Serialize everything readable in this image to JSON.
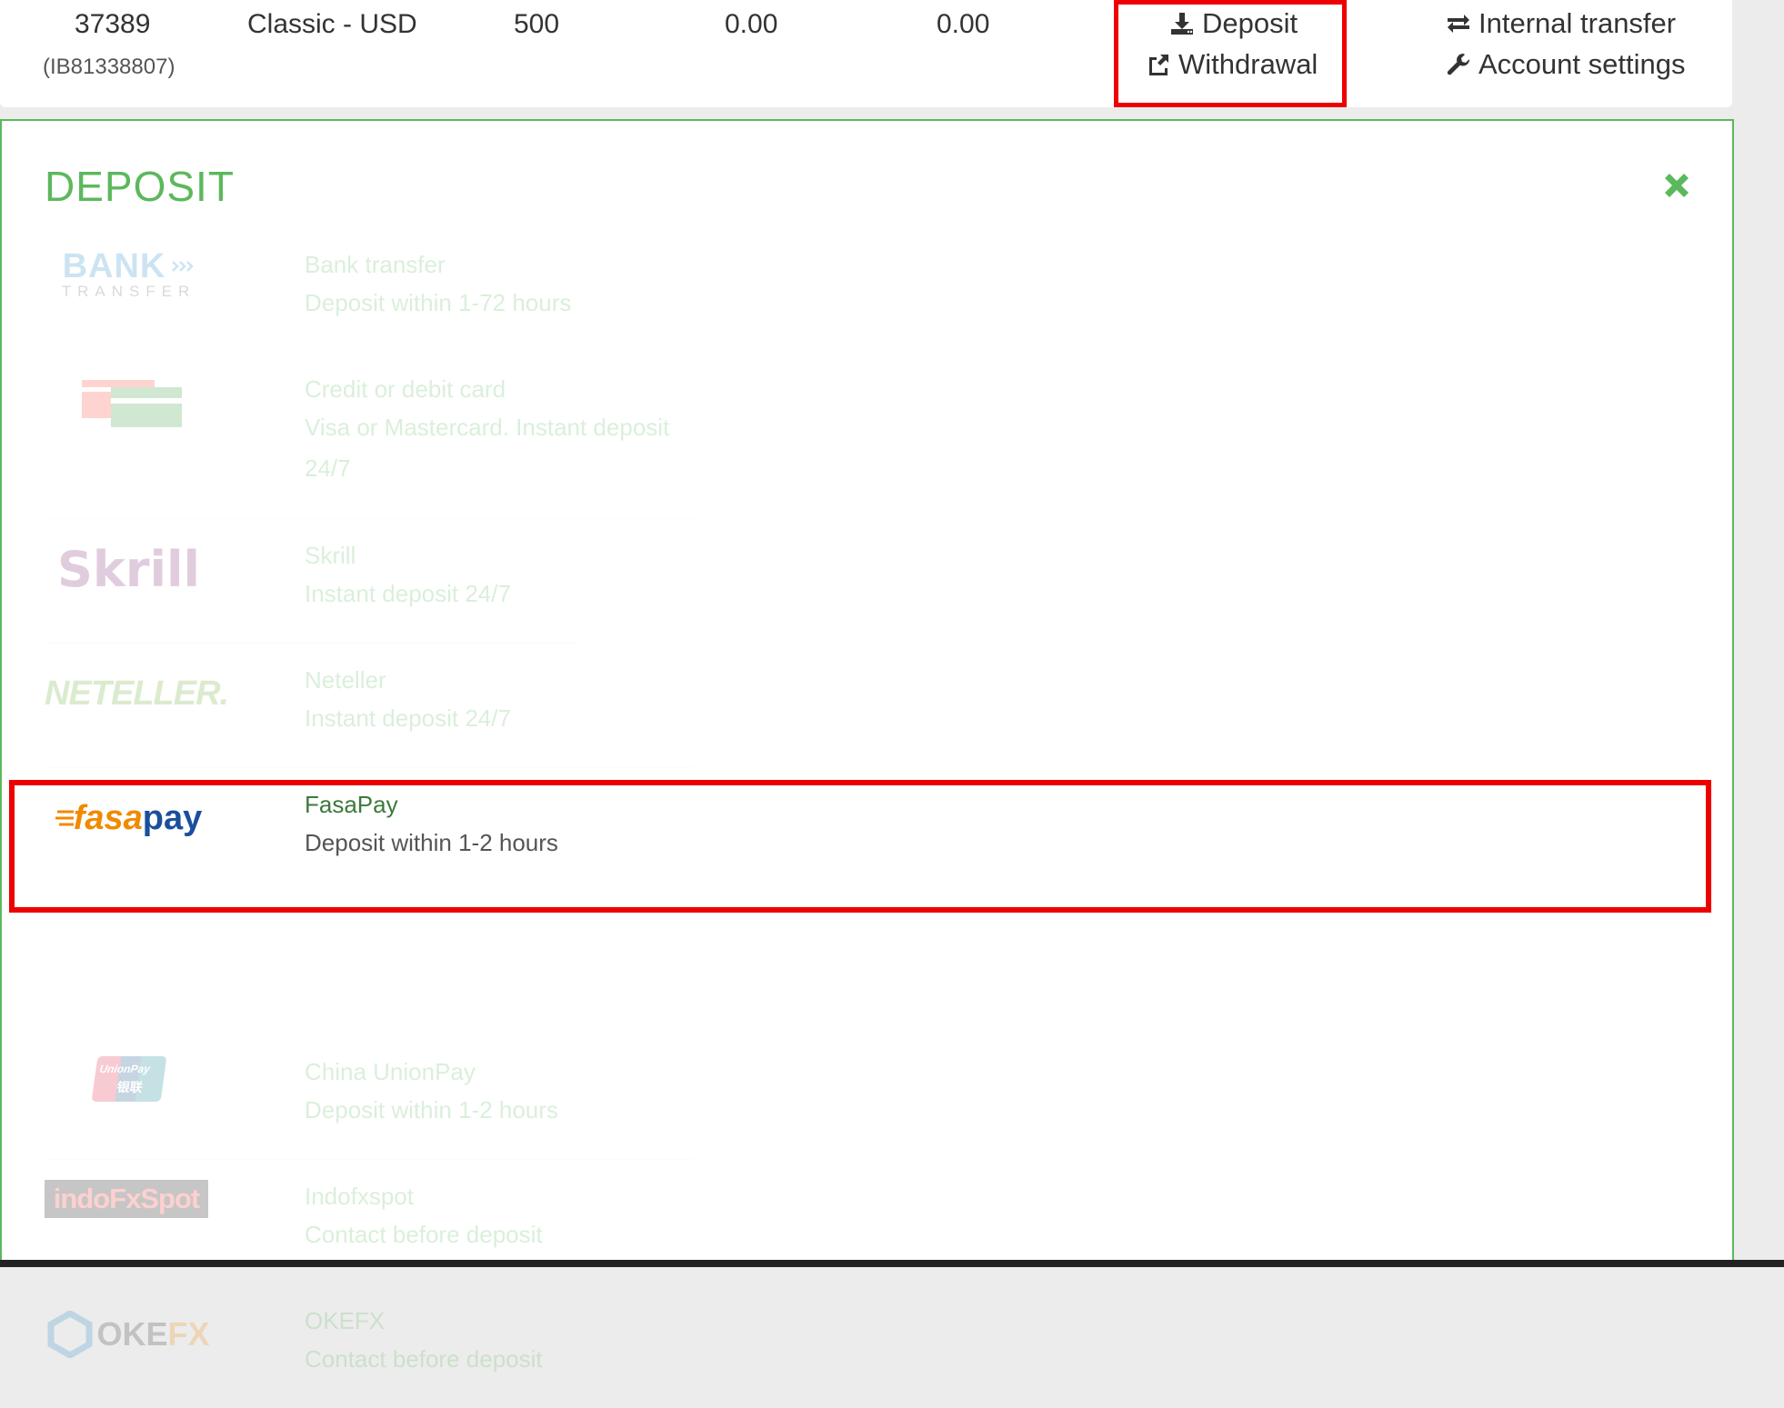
{
  "account": {
    "number": "37389",
    "ib": "(IB81338807)",
    "type": "Classic - USD",
    "leverage": "500",
    "balance": "0.00",
    "equity": "0.00"
  },
  "actions": {
    "deposit": "Deposit",
    "withdrawal": "Withdrawal",
    "internal_transfer": "Internal transfer",
    "account_settings": "Account settings"
  },
  "deposit_panel": {
    "title": "DEPOSIT",
    "accent_color": "#5cb85c",
    "highlight_color": "#ee0000",
    "methods": [
      {
        "name": "Bank transfer",
        "desc": "Deposit within 1-72 hours",
        "logo_text": "BANK",
        "logo_sub": "TRANSFER",
        "state": "disabled"
      },
      {
        "name": "Credit or debit card",
        "desc": "Visa or Mastercard. Instant deposit 24/7",
        "logo_text": "",
        "state": "disabled"
      },
      {
        "name": "Skrill",
        "desc": "Instant deposit 24/7",
        "logo_text": "Skrill",
        "state": "disabled"
      },
      {
        "name": "Neteller",
        "desc": "Instant deposit 24/7",
        "logo_text": "NETELLER.",
        "state": "disabled"
      },
      {
        "name": "FasaPay",
        "desc": "Deposit within 1-2 hours",
        "logo_text": "fasa",
        "logo_text2": "pay",
        "state": "active"
      },
      {
        "name": "China UnionPay",
        "desc": "Deposit within 1-2 hours",
        "logo_text": "UnionPay",
        "logo_sub": "银联",
        "state": "disabled"
      },
      {
        "name": "Indofxspot",
        "desc": "Contact before deposit",
        "logo_text": "indoFxSpot",
        "state": "disabled"
      },
      {
        "name": "OKEFX",
        "desc": "Contact before deposit",
        "logo_text": "OKE",
        "logo_text2": "FX",
        "state": "disabled"
      }
    ]
  }
}
